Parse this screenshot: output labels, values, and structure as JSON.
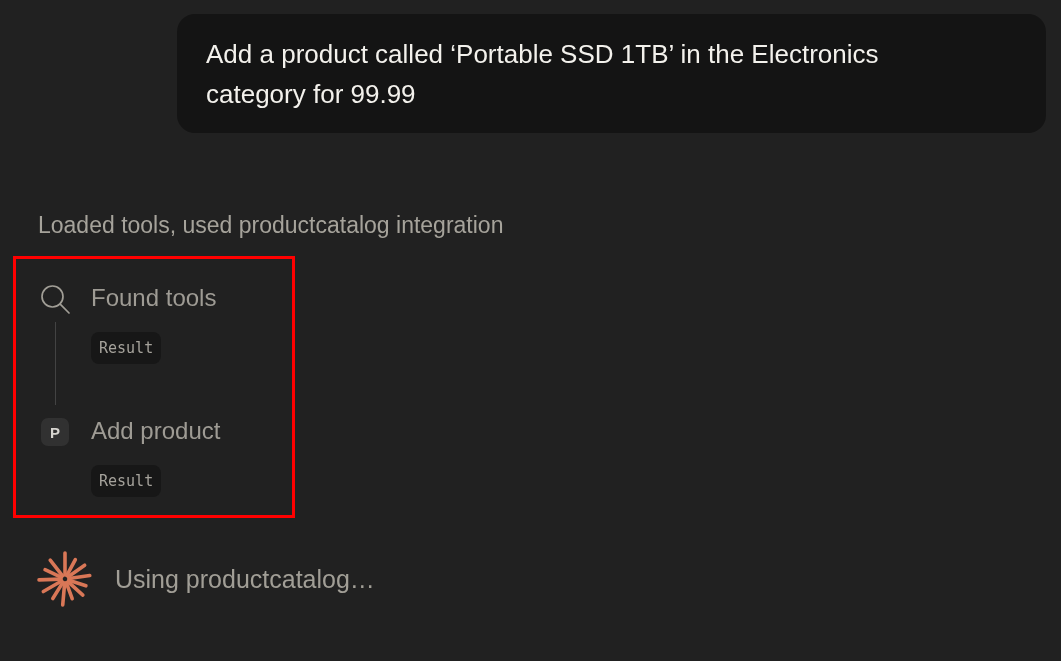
{
  "user_message": {
    "text": "Add a product called ‘Portable SSD 1TB’ in the Electronics category for 99.99"
  },
  "activity": {
    "summary": "Loaded tools, used productcatalog integration",
    "highlighted": true,
    "steps": [
      {
        "kind": "search",
        "title": "Found tools",
        "result": "Result"
      },
      {
        "kind": "letter",
        "letter": "P",
        "title": "Add product",
        "result": "Result"
      }
    ]
  },
  "status": {
    "text": "Using productcatalog…"
  }
}
